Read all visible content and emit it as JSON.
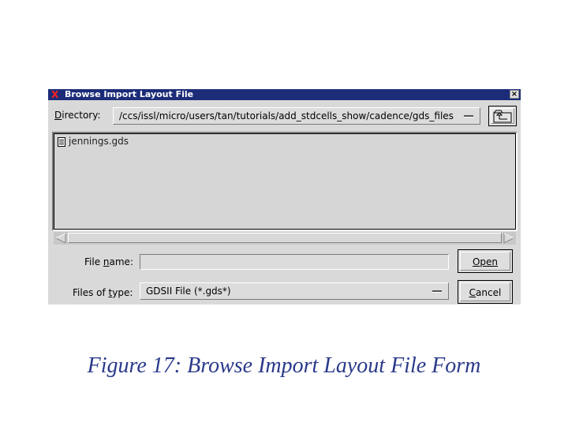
{
  "dialog": {
    "title": "Browse Import Layout File",
    "title_icon": "x-logo-icon",
    "close_label": "×"
  },
  "directory": {
    "label": "Directory:",
    "value": "/ccs/issl/micro/users/tan/tutorials/add_stdcells_show/cadence/gds_files"
  },
  "files": [
    {
      "name": "jennings.gds",
      "icon": "document-icon"
    }
  ],
  "file_name": {
    "label": "File name:",
    "value": ""
  },
  "file_type": {
    "label": "Files of type:",
    "value": "GDSII File (*.gds*)"
  },
  "buttons": {
    "open": "Open",
    "cancel": "Cancel"
  },
  "caption": "Figure 17: Browse Import Layout File Form"
}
